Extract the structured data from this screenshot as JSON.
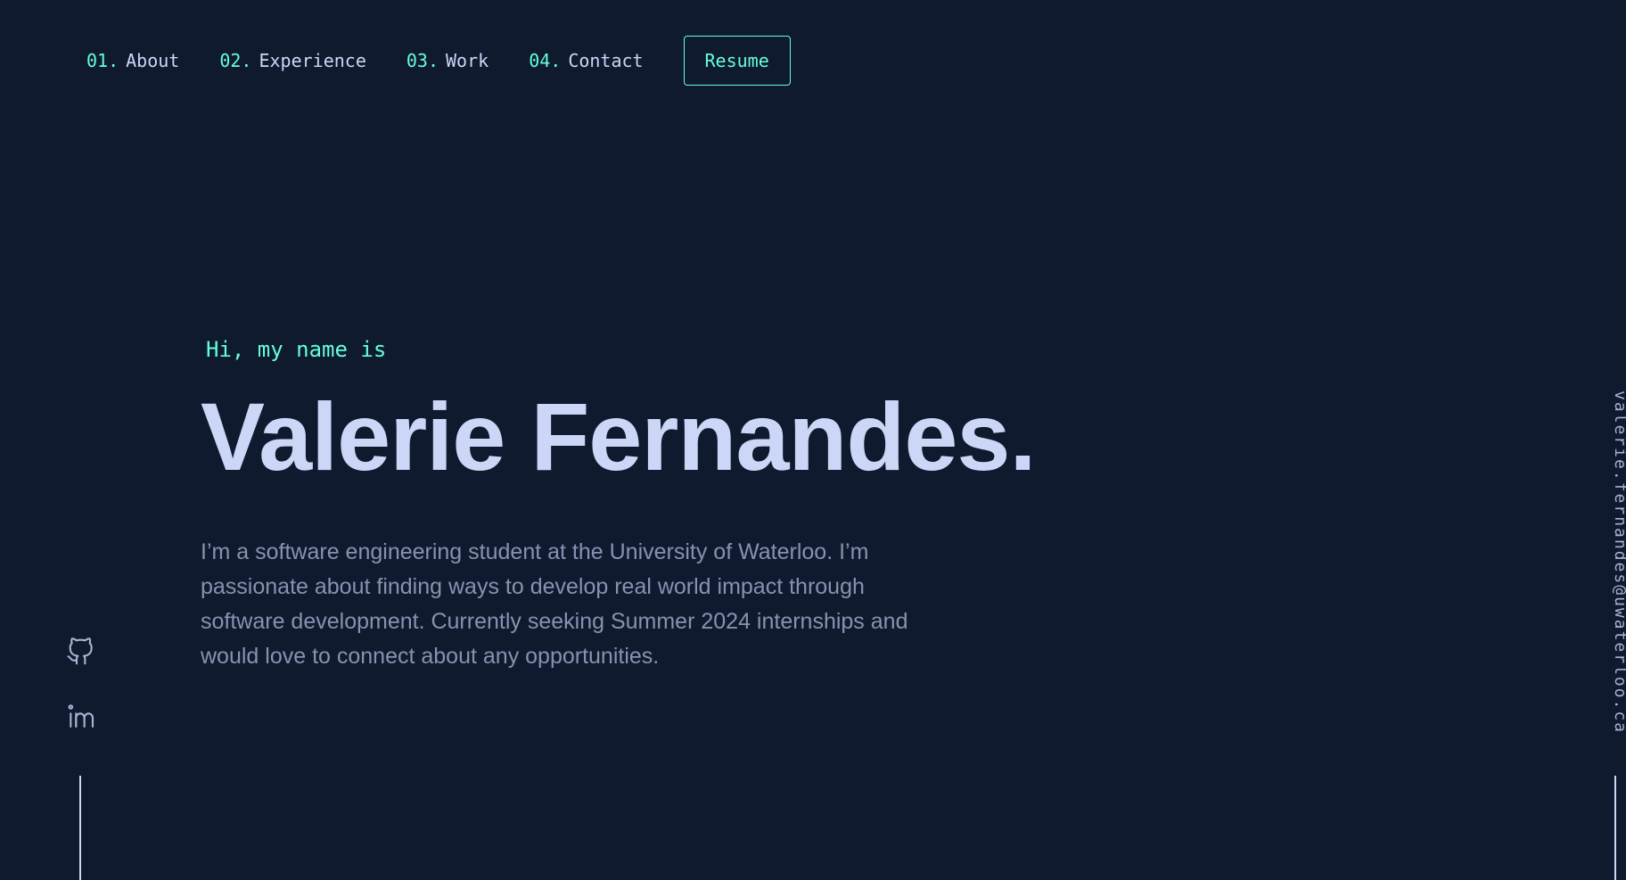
{
  "nav": {
    "items": [
      {
        "num": "01.",
        "label": "About"
      },
      {
        "num": "02.",
        "label": "Experience"
      },
      {
        "num": "03.",
        "label": "Work"
      },
      {
        "num": "04.",
        "label": "Contact"
      }
    ],
    "resume_label": "Resume"
  },
  "hero": {
    "greeting": "Hi, my name is",
    "name": "Valerie Fernandes.",
    "bio": "I’m a software engineering student at the University of Waterloo. I’m passionate about finding ways to develop real world impact through software development. Currently seeking Summer 2024 internships and would love to connect about any opportunities."
  },
  "social": {
    "icons": [
      "github-icon",
      "linkedin-icon"
    ]
  },
  "email": "valerie.fernandes@uwaterloo.ca",
  "colors": {
    "background": "#0f1a2f",
    "accent": "#64ffda",
    "heading": "#ccd6f6",
    "body_text": "#8892b0"
  }
}
